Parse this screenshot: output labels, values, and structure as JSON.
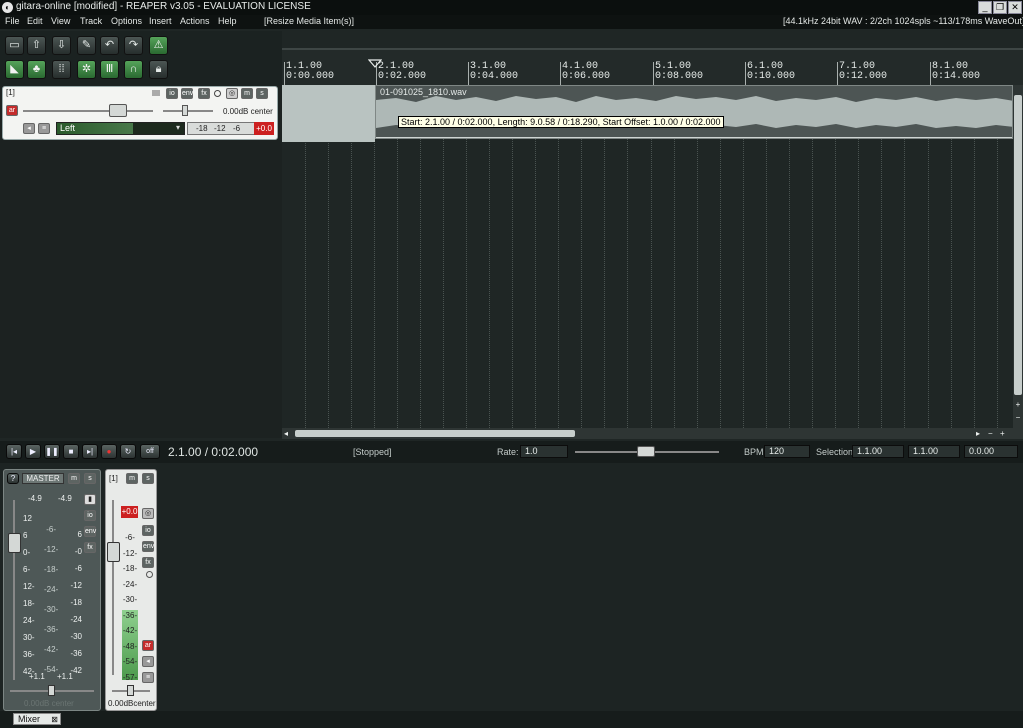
{
  "window": {
    "title": "gitara-online [modified] - REAPER v3.05 - EVALUATION LICENSE",
    "min": "_",
    "restore": "❐",
    "close": "✕"
  },
  "menu": {
    "items": [
      "File",
      "Edit",
      "View",
      "Track",
      "Options",
      "Insert",
      "Actions",
      "Help"
    ],
    "context": "[Resize Media Item(s)]"
  },
  "audio_status": "[44.1kHz 24bit WAV : 2/2ch 1024spls ~113/178ms WaveOut]",
  "toolbar": {
    "row1": [
      "new-file-icon",
      "open-icon",
      "save-icon",
      "wrench-icon",
      "undo-icon",
      "redo-icon",
      "metronome-icon"
    ],
    "row2": [
      "envelope-icon",
      "grouping-icon",
      "grid-icon",
      "ripple-icon",
      "snap-icon",
      "loop-icon",
      "lock-icon"
    ]
  },
  "track": {
    "number": "[1]",
    "volume": "0.00dB center",
    "input": "Left",
    "meter_labels": [
      "-18",
      "-12",
      "-6"
    ],
    "peak": "+0.0",
    "buttons": {
      "io": "io",
      "env": "env",
      "fx": "fx",
      "mute": "m",
      "solo": "s",
      "arm": "ar"
    }
  },
  "ruler": {
    "markers": [
      {
        "bar": "1.1.00",
        "time": "0:00.000"
      },
      {
        "bar": "2.1.00",
        "time": "0:02.000"
      },
      {
        "bar": "3.1.00",
        "time": "0:04.000"
      },
      {
        "bar": "4.1.00",
        "time": "0:06.000"
      },
      {
        "bar": "5.1.00",
        "time": "0:08.000"
      },
      {
        "bar": "6.1.00",
        "time": "0:10.000"
      },
      {
        "bar": "7.1.00",
        "time": "0:12.000"
      },
      {
        "bar": "8.1.00",
        "time": "0:14.000"
      }
    ]
  },
  "item": {
    "name": "01-091025_1810.wav",
    "tooltip": "Start: 2.1.00 / 0:02.000, Length: 9.0.58 / 0:18.290, Start Offset: 1.0.00 / 0:02.000"
  },
  "transport": {
    "position": "2.1.00 / 0:02.000",
    "state": "[Stopped]",
    "rate_label": "Rate:",
    "rate": "1.0",
    "bpm_label": "BPM:",
    "bpm": "120",
    "selection_label": "Selection:",
    "sel_start": "1.1.00",
    "sel_end": "1.1.00",
    "sel_len": "0.0.00",
    "off": "off"
  },
  "mixer": {
    "master": {
      "label": "MASTER",
      "peak_l": "-4.9",
      "peak_r": "-4.9",
      "scale_left": [
        "12",
        "6",
        "0-",
        "6-",
        "12-",
        "18-",
        "24-",
        "30-",
        "36-",
        "42-"
      ],
      "scale_mid": [
        "-6-",
        "-12-",
        "-18-",
        "-24-",
        "-30-",
        "-36-",
        "-42-",
        "-54-"
      ],
      "scale_right": [
        "6",
        "-0",
        "-6",
        "-12",
        "-18",
        "-24",
        "-30",
        "-36",
        "-42"
      ],
      "out_l": "+1.1",
      "out_r": "+1.1",
      "volume": "0.00dB center"
    },
    "ch1": {
      "label": "[1]",
      "peak": "+0.0",
      "scale": [
        "-6-",
        "-12-",
        "-18-",
        "-24-",
        "-30-",
        "-36-",
        "-42-",
        "-48-",
        "-54-",
        "-57-"
      ],
      "volume": "0.00dBcenter"
    },
    "tab": "Mixer"
  }
}
